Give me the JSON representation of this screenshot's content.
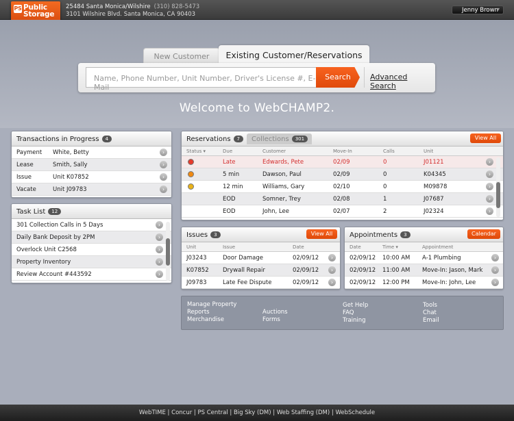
{
  "header": {
    "logo_text": "Public Storage",
    "site_line1": "25484 Santa Monica/Wilshire",
    "phone": "(310) 828-5473",
    "site_line2": "3101 Wilshire Blvd. Santa Monica, CA 90403",
    "user_name": "Jenny Brown"
  },
  "search": {
    "tab_new": "New Customer",
    "tab_existing": "Existing Customer/Reservations",
    "placeholder": "Name, Phone Number, Unit Number, Driver's License #, E-Mail",
    "button": "Search",
    "advanced": "Advanced Search"
  },
  "welcome": "Welcome to WebCHAMP2.",
  "transactions": {
    "title": "Transactions in Progress",
    "count": "4",
    "rows": [
      {
        "type": "Payment",
        "detail": "White, Betty"
      },
      {
        "type": "Lease",
        "detail": "Smith, Sally"
      },
      {
        "type": "Issue",
        "detail": "Unit K07852"
      },
      {
        "type": "Vacate",
        "detail": "Unit J09783"
      }
    ]
  },
  "tasks": {
    "title": "Task List",
    "count": "12",
    "rows": [
      "301 Collection Calls in 5 Days",
      "Daily Bank Deposit by 2PM",
      "Overlock Unit C2568",
      "Property Inventory",
      "Review Account #443592"
    ]
  },
  "reservations": {
    "title": "Reservations",
    "count": "7",
    "tab2": "Collections",
    "tab2_count": "301",
    "view_all": "View All",
    "columns": {
      "status": "Status ▾",
      "due": "Due",
      "customer": "Customer",
      "movein": "Move-In",
      "calls": "Calls",
      "unit": "Unit"
    },
    "rows": [
      {
        "status_color": "#e53b2c",
        "due": "Late",
        "customer": "Edwards, Pete",
        "movein": "02/09",
        "calls": "0",
        "unit": "J01121",
        "alert": true
      },
      {
        "status_color": "#f08a12",
        "due": "5 min",
        "customer": "Dawson, Paul",
        "movein": "02/09",
        "calls": "0",
        "unit": "K04345",
        "alert": false
      },
      {
        "status_color": "#e9b21a",
        "due": "12 min",
        "customer": "Williams, Gary",
        "movein": "02/10",
        "calls": "0",
        "unit": "M09878",
        "alert": false
      },
      {
        "status_color": "",
        "due": "EOD",
        "customer": "Somner, Trey",
        "movein": "02/08",
        "calls": "1",
        "unit": "J07687",
        "alert": false
      },
      {
        "status_color": "",
        "due": "EOD",
        "customer": "John, Lee",
        "movein": "02/07",
        "calls": "2",
        "unit": "J02324",
        "alert": false
      }
    ]
  },
  "issues": {
    "title": "Issues",
    "count": "3",
    "view_all": "View All",
    "columns": {
      "unit": "Unit",
      "issue": "Issue",
      "date": "Date"
    },
    "rows": [
      {
        "unit": "J03243",
        "issue": "Door Damage",
        "date": "02/09/12"
      },
      {
        "unit": "K07852",
        "issue": "Drywall Repair",
        "date": "02/09/12"
      },
      {
        "unit": "J09783",
        "issue": "Late Fee Dispute",
        "date": "02/09/12"
      }
    ]
  },
  "appointments": {
    "title": "Appointments",
    "count": "3",
    "calendar": "Calendar",
    "columns": {
      "date": "Date",
      "time": "Time ▾",
      "appointment": "Appointment"
    },
    "rows": [
      {
        "date": "02/09/12",
        "time": "10:00 AM",
        "appointment": "A-1 Plumbing"
      },
      {
        "date": "02/09/12",
        "time": "11:00 AM",
        "appointment": "Move-In: Jason, Mark"
      },
      {
        "date": "02/09/12",
        "time": "12:00 PM",
        "appointment": "Move-In: John, Lee"
      }
    ]
  },
  "links": {
    "manage_property": "Manage Property",
    "reports": "Reports",
    "merchandise": "Merchandise",
    "auctions": "Auctions",
    "forms": "Forms",
    "get_help": "Get Help",
    "faq": "FAQ",
    "training": "Training",
    "tools": "Tools",
    "chat": "Chat",
    "email": "Email"
  },
  "bottom_nav": [
    "WebTIME",
    "Concur",
    "PS Central",
    "Big Sky (DM)",
    "Web Staffing (DM)",
    "WebSchedule"
  ],
  "colors": {
    "accent": "#e8540f",
    "alert": "#d32f2f"
  }
}
